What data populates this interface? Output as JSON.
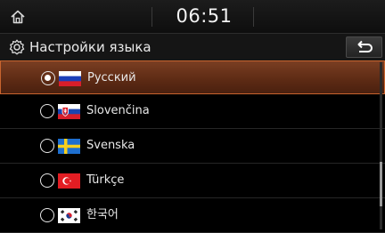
{
  "status": {
    "time": "06:51"
  },
  "header": {
    "title": "Настройки языка",
    "settings_icon": "gear-icon",
    "back_icon": "back-arrow-icon"
  },
  "languages": [
    {
      "label": "Русский",
      "selected": true,
      "flag": "ru"
    },
    {
      "label": "Slovenčina",
      "selected": false,
      "flag": "sk"
    },
    {
      "label": "Svenska",
      "selected": false,
      "flag": "se"
    },
    {
      "label": "Türkçe",
      "selected": false,
      "flag": "tr"
    },
    {
      "label": "한국어",
      "selected": false,
      "flag": "kr"
    }
  ],
  "colors": {
    "accent": "#c8642e",
    "selected_bg": "#5c2a14",
    "background": "#000000"
  }
}
